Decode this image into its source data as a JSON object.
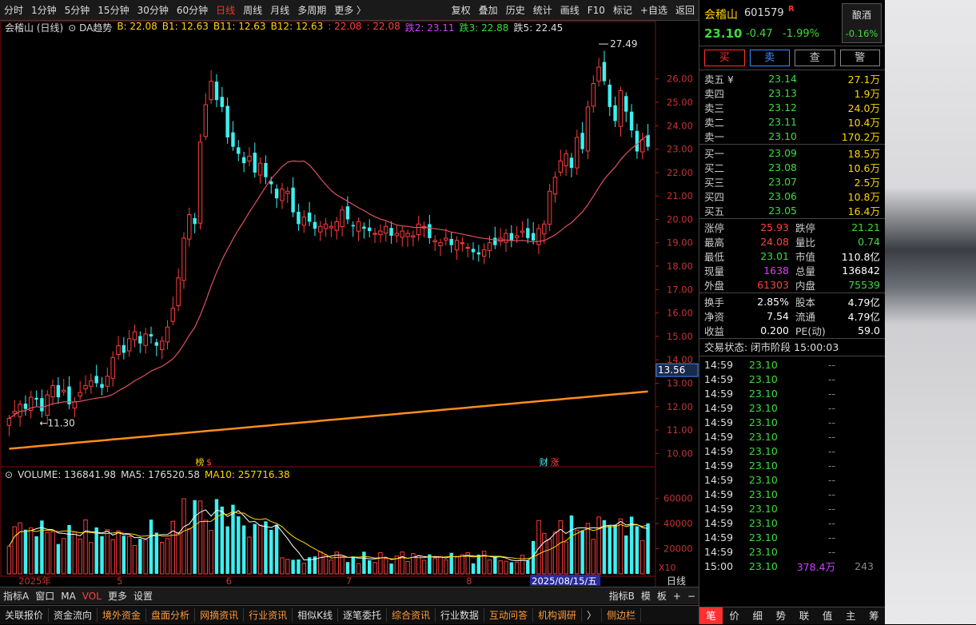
{
  "toolbar": {
    "left_items": [
      "分时",
      "1分钟",
      "5分钟",
      "15分钟",
      "30分钟",
      "60分钟",
      "日线",
      "周线",
      "月线",
      "多周期",
      "更多 〉"
    ],
    "active": "日线",
    "right_items": [
      "复权",
      "叠加",
      "历史",
      "统计",
      "画线",
      "F10",
      "标记",
      "+自选",
      "返回"
    ]
  },
  "chart": {
    "title": "会稽山 (日线)",
    "indicator": "DA趋势",
    "ind_vals": [
      {
        "label": "B: 22.08",
        "color": "#ffd700"
      },
      {
        "label": "B1: 12.63",
        "color": "#ffd700"
      },
      {
        "label": "B11: 12.63",
        "color": "#ffd700"
      },
      {
        "label": "B12: 12.63",
        "color": "#ffd700"
      },
      {
        "label": ": 22.08",
        "color": "#ff4040"
      },
      {
        "label": ": 22.08",
        "color": "#ff4040"
      },
      {
        "label": "跌2: 23.11",
        "color": "#d040ff"
      },
      {
        "label": "跌3: 22.88",
        "color": "#3cdc3c"
      },
      {
        "label": "跌5: 22.45",
        "color": "#dddddd"
      }
    ],
    "price_high_label": "27.49",
    "price_low_label": "11.30",
    "current_price_tag": "13.56",
    "price_axis": [
      "26.00",
      "25.00",
      "24.00",
      "23.00",
      "22.00",
      "21.00",
      "20.00",
      "19.00",
      "18.00",
      "17.00",
      "16.00",
      "15.00",
      "14.00",
      "13.00",
      "12.00",
      "11.00",
      "10.00"
    ],
    "markers": [
      {
        "label": "榜",
        "color": "#ffd700"
      },
      {
        "label": "$",
        "color": "#ff4040"
      },
      {
        "label": "财",
        "color": "#3cf0f0"
      },
      {
        "label": "涨",
        "color": "#ff4040"
      }
    ],
    "volume_title": "VOLUME: 136841.98",
    "ma5_label": "MA5: 176520.58",
    "ma10_label": "MA10: 257716.38",
    "vol_axis": [
      "60000",
      "40000",
      "20000"
    ],
    "vol_unit": "X10",
    "date_labels": [
      "2025年",
      "5",
      "6",
      "7",
      "8"
    ],
    "date_highlight": "2025/08/15/五",
    "period_label": "日线"
  },
  "chart_data": {
    "type": "candlestick",
    "ylim": [
      9.5,
      27.8
    ],
    "closes": [
      11.5,
      11.8,
      12.1,
      11.9,
      12.4,
      12.3,
      11.8,
      12.5,
      12.9,
      12.4,
      12.7,
      12.1,
      12.2,
      12.6,
      12.9,
      13.1,
      13.0,
      12.8,
      13.3,
      14.1,
      14.6,
      14.3,
      14.9,
      15.2,
      14.7,
      15.1,
      15.0,
      14.6,
      14.8,
      15.4,
      16.2,
      17.5,
      19.2,
      20.2,
      19.8,
      23.3,
      24.9,
      25.9,
      25.1,
      24.8,
      23.5,
      23.1,
      22.8,
      22.4,
      22.7,
      22.0,
      22.4,
      21.8,
      21.5,
      20.9,
      21.3,
      21.2,
      20.3,
      19.8,
      20.1,
      19.9,
      19.6,
      19.7,
      19.8,
      19.7,
      19.9,
      20.4,
      20.0,
      19.7,
      19.9,
      19.6,
      19.5,
      19.4,
      19.5,
      19.7,
      19.3,
      19.4,
      19.5,
      19.4,
      19.3,
      19.8,
      19.7,
      19.2,
      19.1,
      19.0,
      19.2,
      18.9,
      19.1,
      19.0,
      18.8,
      18.6,
      18.5,
      18.7,
      19.0,
      18.9,
      19.2,
      19.4,
      19.1,
      19.3,
      19.5,
      19.2,
      19.1,
      19.6,
      19.8,
      21.2,
      21.8,
      22.5,
      22.8,
      22.2,
      23.5,
      23.0,
      24.8,
      25.8,
      26.5,
      25.9,
      24.8,
      24.2,
      25.5,
      24.6,
      23.8,
      22.9,
      23.4,
      23.1
    ]
  },
  "quote": {
    "name": "会稽山",
    "code": "601579",
    "badge": "R",
    "price": "23.10",
    "change": "-0.47",
    "pct": "-1.99%",
    "sector": "酿酒",
    "sector_pct": "-0.16%",
    "buttons": [
      "买",
      "卖",
      "查",
      "警"
    ],
    "asks": [
      {
        "label": "卖五 ¥",
        "price": "23.14",
        "vol": "27.1万",
        "pc": "green"
      },
      {
        "label": "卖四",
        "price": "23.13",
        "vol": "1.9万",
        "pc": "green"
      },
      {
        "label": "卖三",
        "price": "23.12",
        "vol": "24.0万",
        "pc": "green"
      },
      {
        "label": "卖二",
        "price": "23.11",
        "vol": "10.4万",
        "pc": "green"
      },
      {
        "label": "卖一",
        "price": "23.10",
        "vol": "170.2万",
        "pc": "green"
      }
    ],
    "bids": [
      {
        "label": "买一",
        "price": "23.09",
        "vol": "18.5万",
        "pc": "green"
      },
      {
        "label": "买二",
        "price": "23.08",
        "vol": "10.6万",
        "pc": "green"
      },
      {
        "label": "买三",
        "price": "23.07",
        "vol": "2.5万",
        "pc": "green"
      },
      {
        "label": "买四",
        "price": "23.06",
        "vol": "10.8万",
        "pc": "green"
      },
      {
        "label": "买五",
        "price": "23.05",
        "vol": "16.4万",
        "pc": "green"
      }
    ],
    "stats1": [
      {
        "l1": "涨停",
        "v1": "25.93",
        "c1": "red",
        "l2": "跌停",
        "v2": "21.21",
        "c2": "green"
      },
      {
        "l1": "最高",
        "v1": "24.08",
        "c1": "red",
        "l2": "量比",
        "v2": "0.74",
        "c2": "green"
      },
      {
        "l1": "最低",
        "v1": "23.01",
        "c1": "green",
        "l2": "市值",
        "v2": "110.8亿",
        "c2": "white"
      },
      {
        "l1": "现量",
        "v1": "1638",
        "c1": "purple",
        "l2": "总量",
        "v2": "136842",
        "c2": "white"
      },
      {
        "l1": "外盘",
        "v1": "61303",
        "c1": "red",
        "l2": "内盘",
        "v2": "75539",
        "c2": "green"
      }
    ],
    "stats2": [
      {
        "l1": "换手",
        "v1": "2.85%",
        "c1": "white",
        "l2": "股本",
        "v2": "4.79亿",
        "c2": "white"
      },
      {
        "l1": "净资",
        "v1": "7.54",
        "c1": "white",
        "l2": "流通",
        "v2": "4.79亿",
        "c2": "white"
      },
      {
        "l1": "收益",
        "v1": "0.200",
        "c1": "white",
        "l2": "PE(动)",
        "v2": "59.0",
        "c2": "white"
      }
    ],
    "trade_status": "交易状态: 闭市阶段 15:00:03",
    "ticks": [
      {
        "t": "14:59",
        "p": "23.10",
        "v": "--",
        "n": ""
      },
      {
        "t": "14:59",
        "p": "23.10",
        "v": "--",
        "n": ""
      },
      {
        "t": "14:59",
        "p": "23.10",
        "v": "--",
        "n": ""
      },
      {
        "t": "14:59",
        "p": "23.10",
        "v": "--",
        "n": ""
      },
      {
        "t": "14:59",
        "p": "23.10",
        "v": "--",
        "n": ""
      },
      {
        "t": "14:59",
        "p": "23.10",
        "v": "--",
        "n": ""
      },
      {
        "t": "14:59",
        "p": "23.10",
        "v": "--",
        "n": ""
      },
      {
        "t": "14:59",
        "p": "23.10",
        "v": "--",
        "n": ""
      },
      {
        "t": "14:59",
        "p": "23.10",
        "v": "--",
        "n": ""
      },
      {
        "t": "14:59",
        "p": "23.10",
        "v": "--",
        "n": ""
      },
      {
        "t": "14:59",
        "p": "23.10",
        "v": "--",
        "n": ""
      },
      {
        "t": "14:59",
        "p": "23.10",
        "v": "--",
        "n": ""
      },
      {
        "t": "14:59",
        "p": "23.10",
        "v": "--",
        "n": ""
      },
      {
        "t": "14:59",
        "p": "23.10",
        "v": "--",
        "n": ""
      },
      {
        "t": "15:00",
        "p": "23.10",
        "v": "378.4万",
        "n": "243"
      }
    ],
    "tabs": [
      "笔",
      "价",
      "细",
      "势",
      "联",
      "值",
      "主",
      "筹"
    ]
  },
  "bottom": {
    "row1": [
      "指标A",
      "窗口",
      "MA",
      "VOL",
      "更多",
      "设置"
    ],
    "row1_right": [
      "指标B",
      "模",
      "板",
      "+",
      "−"
    ],
    "row2": [
      "关联报价",
      "资金流向",
      "境外资金",
      "盘面分析",
      "网摘资讯",
      "行业资讯",
      "相似K线",
      "逐笔委托",
      "综合资讯",
      "行业数据",
      "互动问答",
      "机构调研",
      "〉",
      "侧边栏"
    ]
  }
}
